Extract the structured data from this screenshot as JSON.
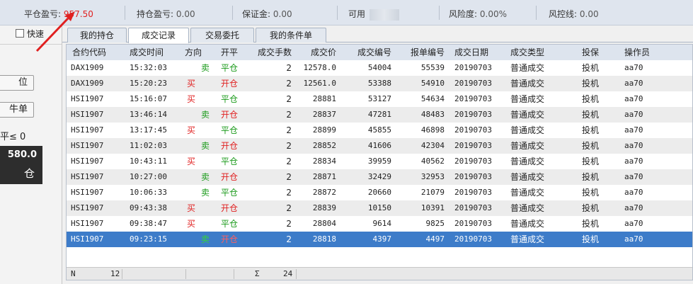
{
  "topbar": {
    "close_pnl_label": "平仓盈亏:",
    "close_pnl_value": "957.50",
    "hold_pnl_label": "持仓盈亏:",
    "hold_pnl_value": "0.00",
    "margin_label": "保证金:",
    "margin_value": "0.00",
    "available_label": "可用",
    "risk_label": "风险度:",
    "risk_value": "0.00%",
    "control_label": "风控线:",
    "control_value": "0.00"
  },
  "left": {
    "quick_label": "快速",
    "btn1": "位",
    "btn2": "牛单",
    "cond_text": "平≤ 0",
    "dark_value": "580.0",
    "dark_label": "仓"
  },
  "tabs": [
    "我的持仓",
    "成交记录",
    "交易委托",
    "我的条件单"
  ],
  "active_tab": 1,
  "columns": [
    "合约代码",
    "成交时间",
    "方向",
    "开平",
    "成交手数",
    "成交价",
    "成交编号",
    "报单编号",
    "成交日期",
    "成交类型",
    "投保",
    "操作员"
  ],
  "rows": [
    [
      "DAX1909",
      "15:32:03",
      "卖",
      "平仓",
      "2",
      "12578.0",
      "54004",
      "55539",
      "20190703",
      "普通成交",
      "投机",
      "aa70"
    ],
    [
      "DAX1909",
      "15:20:23",
      "买",
      "开仓",
      "2",
      "12561.0",
      "53388",
      "54910",
      "20190703",
      "普通成交",
      "投机",
      "aa70"
    ],
    [
      "HSI1907",
      "15:16:07",
      "买",
      "平仓",
      "2",
      "28881",
      "53127",
      "54634",
      "20190703",
      "普通成交",
      "投机",
      "aa70"
    ],
    [
      "HSI1907",
      "13:46:14",
      "卖",
      "开仓",
      "2",
      "28837",
      "47281",
      "48483",
      "20190703",
      "普通成交",
      "投机",
      "aa70"
    ],
    [
      "HSI1907",
      "13:17:45",
      "买",
      "平仓",
      "2",
      "28899",
      "45855",
      "46898",
      "20190703",
      "普通成交",
      "投机",
      "aa70"
    ],
    [
      "HSI1907",
      "11:02:03",
      "卖",
      "开仓",
      "2",
      "28852",
      "41606",
      "42304",
      "20190703",
      "普通成交",
      "投机",
      "aa70"
    ],
    [
      "HSI1907",
      "10:43:11",
      "买",
      "平仓",
      "2",
      "28834",
      "39959",
      "40562",
      "20190703",
      "普通成交",
      "投机",
      "aa70"
    ],
    [
      "HSI1907",
      "10:27:00",
      "卖",
      "开仓",
      "2",
      "28871",
      "32429",
      "32953",
      "20190703",
      "普通成交",
      "投机",
      "aa70"
    ],
    [
      "HSI1907",
      "10:06:33",
      "卖",
      "平仓",
      "2",
      "28872",
      "20660",
      "21079",
      "20190703",
      "普通成交",
      "投机",
      "aa70"
    ],
    [
      "HSI1907",
      "09:43:38",
      "买",
      "开仓",
      "2",
      "28839",
      "10150",
      "10391",
      "20190703",
      "普通成交",
      "投机",
      "aa70"
    ],
    [
      "HSI1907",
      "09:38:47",
      "买",
      "平仓",
      "2",
      "28804",
      "9614",
      "9825",
      "20190703",
      "普通成交",
      "投机",
      "aa70"
    ],
    [
      "HSI1907",
      "09:23:15",
      "卖",
      "开仓",
      "2",
      "28818",
      "4397",
      "4497",
      "20190703",
      "普通成交",
      "投机",
      "aa70"
    ]
  ],
  "selected_row": 11,
  "footer": {
    "count_label": "N",
    "count_value": "12",
    "sum_label": "Σ",
    "sum_value": "24"
  },
  "colors": {
    "loss_red": "#e02020",
    "buy": "#e02020",
    "sell": "#1a9a1a",
    "selected": "#3d7cc9"
  }
}
